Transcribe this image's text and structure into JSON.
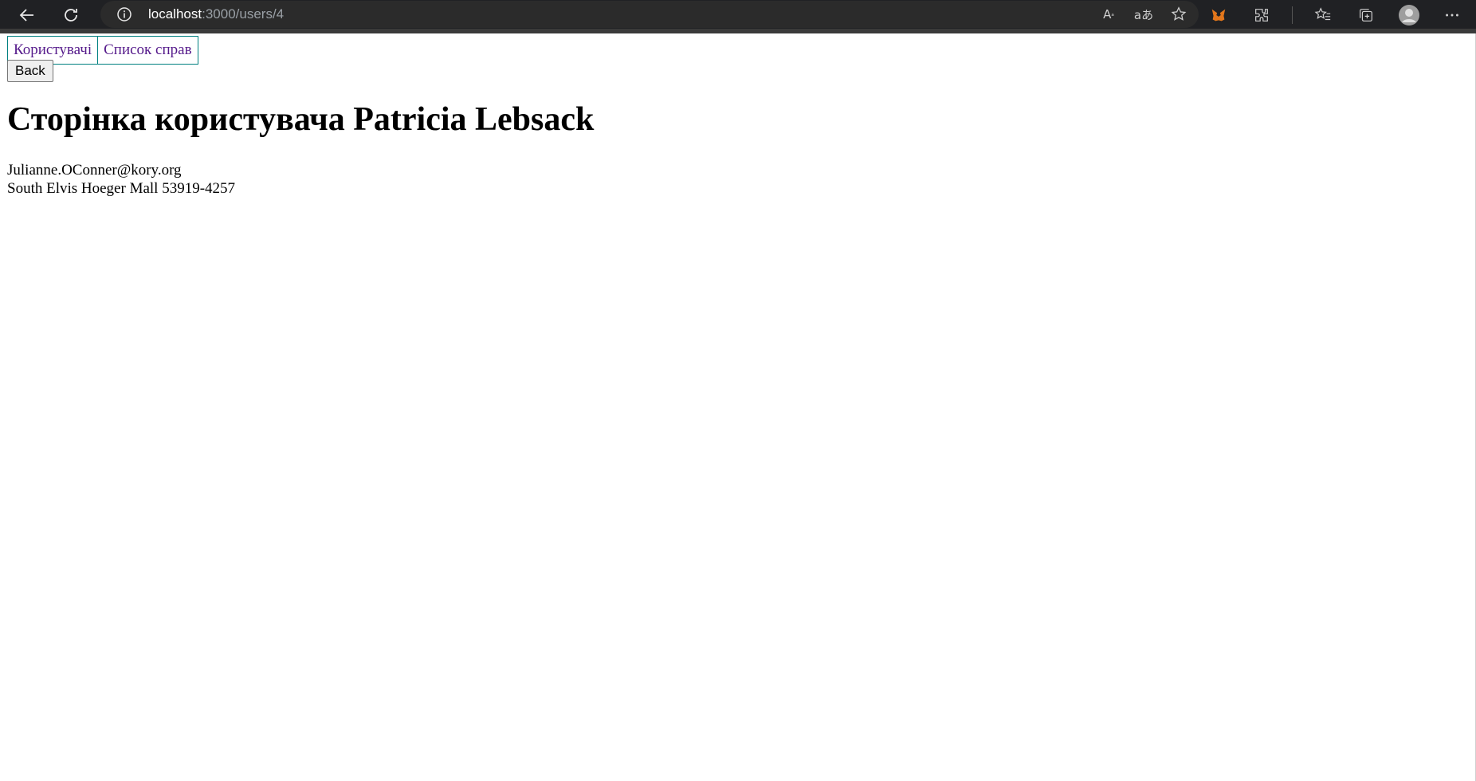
{
  "browser": {
    "url_host": "localhost",
    "url_path": ":3000/users/4",
    "icons": {
      "back": "back-arrow-icon",
      "refresh": "refresh-icon",
      "info": "info-icon",
      "read_aloud": "read-aloud-icon",
      "translate": "translate-icon",
      "add_favorite": "add-favorite-icon",
      "metamask": "metamask-fox-icon",
      "extensions": "extensions-icon",
      "favorites": "favorites-icon",
      "collections": "collections-icon",
      "profile": "profile-avatar-icon",
      "more": "more-icon"
    }
  },
  "nav": {
    "users_label": "Користувачі",
    "todos_label": "Список справ"
  },
  "back_label": "Back",
  "user": {
    "title": "Сторінка користувача Patricia Lebsack",
    "email": "Julianne.OConner@kory.org",
    "address": "South Elvis Hoeger Mall 53919-4257"
  },
  "colors": {
    "link": "#551a8b",
    "nav_border": "#008080",
    "chrome_bg": "#202124"
  }
}
